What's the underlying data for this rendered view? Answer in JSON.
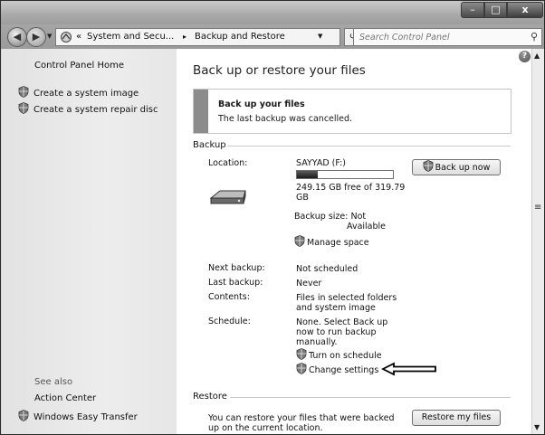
{
  "window": {
    "controls": {
      "minimize": "–",
      "maximize": "□",
      "close": "x"
    }
  },
  "address_bar": {
    "chevron": "«",
    "breadcrumbs": [
      "System and Secu...",
      "Backup and Restore"
    ],
    "separator": "▸",
    "search_placeholder": "Search Control Panel"
  },
  "sidebar": {
    "home": "Control Panel Home",
    "tasks": [
      "Create a system image",
      "Create a system repair disc"
    ],
    "see_also_heading": "See also",
    "see_also": [
      "Action Center",
      "Windows Easy Transfer"
    ]
  },
  "main": {
    "title": "Back up or restore your files",
    "notice": {
      "title": "Back up your files",
      "text": "The last backup was cancelled."
    },
    "backup_section": {
      "heading": "Backup",
      "location_label": "Location:",
      "location_value": "SAYYAD (F:)",
      "free_space_line1": "249.15 GB free of 319.79",
      "free_space_line2": "GB",
      "used_fraction": 0.22,
      "backup_size_line1": "Backup size: Not",
      "backup_size_line2": "Available",
      "manage_space": "Manage space",
      "back_up_now": "Back up now",
      "next_backup_label": "Next backup:",
      "next_backup_value": "Not scheduled",
      "last_backup_label": "Last backup:",
      "last_backup_value": "Never",
      "contents_label": "Contents:",
      "contents_line1": "Files in selected folders",
      "contents_line2": "and system image",
      "schedule_label": "Schedule:",
      "schedule_line1": "None. Select Back up",
      "schedule_line2": "now to run backup",
      "schedule_line3": "manually.",
      "turn_on_schedule": "Turn on schedule",
      "change_settings": "Change settings"
    },
    "restore_section": {
      "heading": "Restore",
      "text_line1": "You can restore your files that were backed",
      "text_line2": "up on the current location.",
      "restore_button": "Restore my files"
    }
  },
  "help": "?",
  "colors": {
    "progress_fill": "#1c1c1c",
    "notice_bar": "#8c8c8c"
  }
}
